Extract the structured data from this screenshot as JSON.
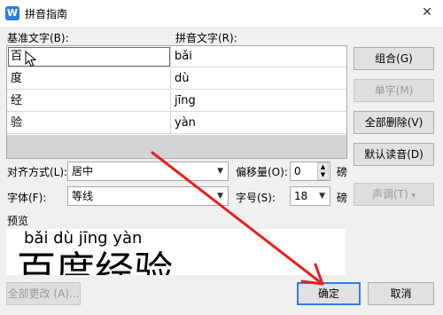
{
  "window": {
    "title": "拼音指南",
    "icon_letter": "W",
    "close_glyph": "✕"
  },
  "grid": {
    "base_header": "基准文字(B):",
    "pinyin_header": "拼音文字(R):",
    "rows": [
      {
        "base": "百",
        "pinyin": "bǎi"
      },
      {
        "base": "度",
        "pinyin": "dù"
      },
      {
        "base": "经",
        "pinyin": "jīng"
      },
      {
        "base": "验",
        "pinyin": "yàn"
      }
    ]
  },
  "buttons": {
    "combine": "组合(G)",
    "single": "单字(M)",
    "delete_all": "全部删除(V)",
    "default_reading": "默认读音(D)",
    "tone": "声调(T)",
    "modify_all": "全部更改 (A)...",
    "ok": "确定",
    "cancel": "取消"
  },
  "options": {
    "align_label": "对齐方式(L):",
    "align_value": "居中",
    "offset_label": "偏移量(O):",
    "offset_value": "0",
    "offset_unit": "磅",
    "font_label": "字体(F):",
    "font_value": "等线",
    "size_label": "字号(S):",
    "size_value": "18",
    "size_unit": "磅"
  },
  "preview": {
    "label": "预览",
    "pinyin": "bǎi  dù  jīng  yàn",
    "chars": "百度经验"
  },
  "colors": {
    "accent": "#2b7de9",
    "annotation": "#e8201e"
  }
}
